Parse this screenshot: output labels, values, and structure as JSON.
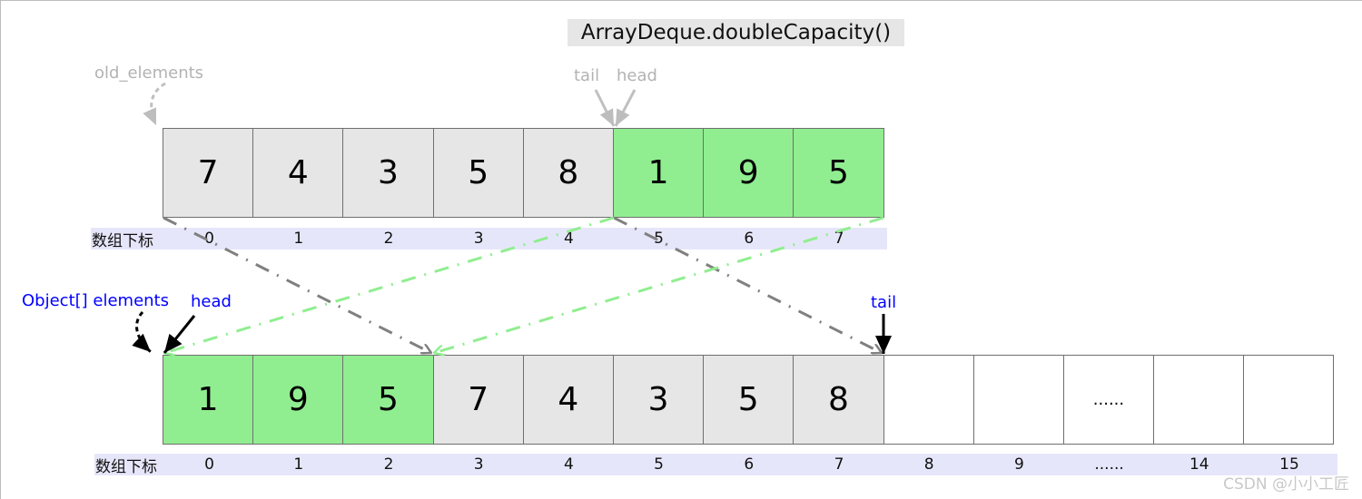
{
  "title": "ArrayDeque.doubleCapacity()",
  "colors": {
    "occupied_gray": "#e6e6e6",
    "moved_green": "#90ee90",
    "empty": "#ffffff",
    "index_strip": "#e6e6fa",
    "old_label": "#b3b3b3",
    "new_label": "#0000ff",
    "gray_arrow": "#808080",
    "green_arrow": "#90ee90"
  },
  "old_array": {
    "pointer_label": "old_elements",
    "tail_label": "tail",
    "head_label": "head",
    "index_label": "数组下标",
    "cells": [
      {
        "value": "7",
        "state": "gray"
      },
      {
        "value": "4",
        "state": "gray"
      },
      {
        "value": "3",
        "state": "gray"
      },
      {
        "value": "5",
        "state": "gray"
      },
      {
        "value": "8",
        "state": "gray"
      },
      {
        "value": "1",
        "state": "green"
      },
      {
        "value": "9",
        "state": "green"
      },
      {
        "value": "5",
        "state": "green"
      }
    ],
    "indices": [
      "0",
      "1",
      "2",
      "3",
      "4",
      "5",
      "6",
      "7"
    ]
  },
  "new_array": {
    "pointer_label": "Object[] elements",
    "head_label": "head",
    "tail_label": "tail",
    "index_label": "数组下标",
    "cells": [
      {
        "value": "1",
        "state": "green"
      },
      {
        "value": "9",
        "state": "green"
      },
      {
        "value": "5",
        "state": "green"
      },
      {
        "value": "7",
        "state": "gray"
      },
      {
        "value": "4",
        "state": "gray"
      },
      {
        "value": "3",
        "state": "gray"
      },
      {
        "value": "5",
        "state": "gray"
      },
      {
        "value": "8",
        "state": "gray"
      },
      {
        "value": "",
        "state": "empty"
      },
      {
        "value": "",
        "state": "empty"
      },
      {
        "value": "......",
        "state": "empty"
      },
      {
        "value": "",
        "state": "empty"
      },
      {
        "value": "",
        "state": "empty"
      }
    ],
    "indices": [
      "0",
      "1",
      "2",
      "3",
      "4",
      "5",
      "6",
      "7",
      "8",
      "9",
      "......",
      "14",
      "15"
    ]
  },
  "copy_arrows": [
    {
      "from_old_index_range": [
        0,
        5
      ],
      "to_new_index_range": [
        3,
        8
      ],
      "color": "gray"
    },
    {
      "from_old_index_range": [
        5,
        8
      ],
      "to_new_index_range": [
        0,
        3
      ],
      "color": "green"
    }
  ],
  "watermark": "CSDN @小小工匠"
}
